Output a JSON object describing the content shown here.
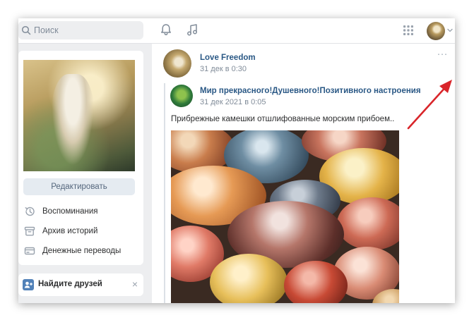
{
  "search": {
    "placeholder": "Поиск"
  },
  "sidebar": {
    "edit_label": "Редактировать",
    "items": [
      {
        "label": "Воспоминания",
        "icon": "clock-history-icon"
      },
      {
        "label": "Архив историй",
        "icon": "archive-icon"
      },
      {
        "label": "Денежные переводы",
        "icon": "money-transfer-icon"
      }
    ],
    "friends": {
      "label": "Найдите друзей",
      "close": "×"
    }
  },
  "post": {
    "author": "Love Freedom",
    "date": "31 дек в 0:30",
    "more": "···",
    "repost": {
      "author": "Мир прекрасного!Душевного!Позитивного настроения",
      "date": "31 дек 2021 в 0:05",
      "text": "Прибрежные камешки отшлифованные морским прибоем.."
    }
  },
  "colors": {
    "page_bg": "#edeef0",
    "link": "#2a5885",
    "secondary_text": "#818c99",
    "button_bg": "#e5ebf1",
    "annotation_arrow": "#d9252a"
  }
}
